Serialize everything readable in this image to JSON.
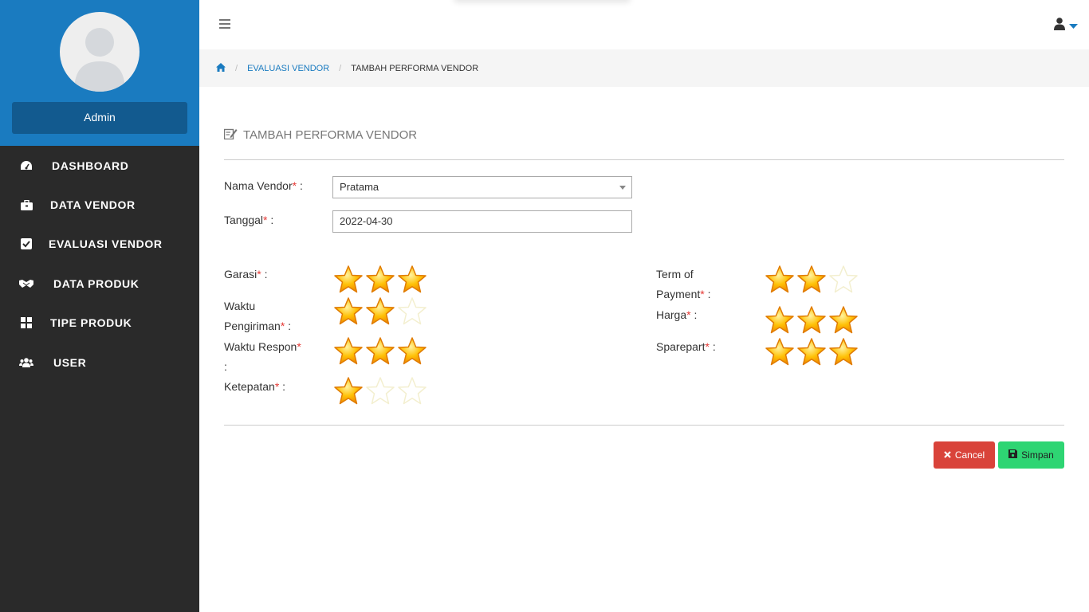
{
  "sidebar": {
    "user_name": "Admin",
    "items": [
      {
        "label": "DASHBOARD",
        "icon": "dashboard-icon"
      },
      {
        "label": "DATA VENDOR",
        "icon": "briefcase-icon"
      },
      {
        "label": "EVALUASI VENDOR",
        "icon": "check-square-icon"
      },
      {
        "label": "DATA PRODUK",
        "icon": "handshake-icon"
      },
      {
        "label": "TIPE PRODUK",
        "icon": "grid-icon"
      },
      {
        "label": "USER",
        "icon": "users-icon"
      }
    ]
  },
  "breadcrumb": {
    "items": [
      "EVALUASI VENDOR",
      "TAMBAH PERFORMA VENDOR"
    ]
  },
  "form": {
    "title": "TAMBAH PERFORMA VENDOR",
    "vendor": {
      "label": "Nama Vendor",
      "value": "Pratama"
    },
    "tanggal": {
      "label": "Tanggal",
      "value": "2022-04-30"
    },
    "ratings_left": [
      {
        "label": "Garasi",
        "value": 3,
        "max": 3
      },
      {
        "label_1": "Waktu",
        "label_2": "Pengiriman",
        "value": 2,
        "max": 3
      },
      {
        "label_1": "Waktu Respon",
        "label_2": ":",
        "value": 3,
        "max": 3
      },
      {
        "label": "Ketepatan",
        "value": 1,
        "max": 3
      }
    ],
    "ratings_right": [
      {
        "label_1": "Term of",
        "label_2": "Payment",
        "value": 2,
        "max": 3
      },
      {
        "label": "Harga",
        "value": 3,
        "max": 3
      },
      {
        "label": "Sparepart",
        "value": 3,
        "max": 3
      }
    ],
    "required_mark": "*",
    "colon": " :",
    "cancel_label": "Cancel",
    "save_label": "Simpan"
  },
  "colors": {
    "sidebar_header": "#1a7bc0",
    "sidebar_bg": "#2a2a2a",
    "star_fill": "#ffc107",
    "cancel": "#d9433a",
    "save": "#2ed573"
  }
}
